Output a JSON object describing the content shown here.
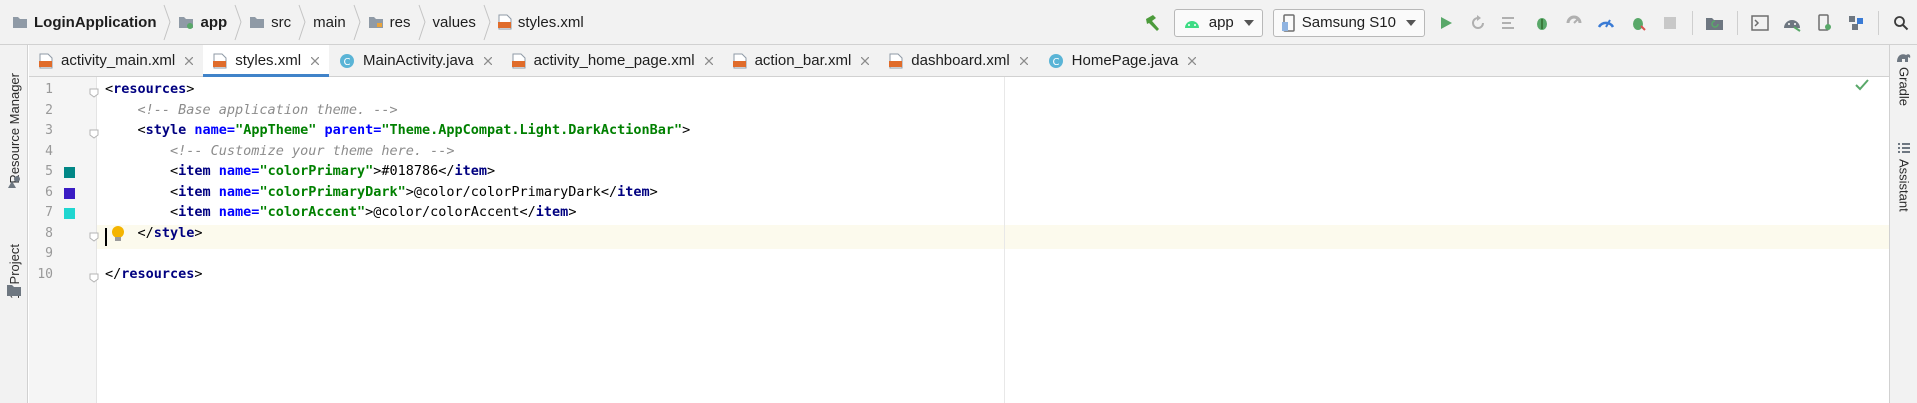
{
  "breadcrumbs": [
    {
      "label": "LoginApplication",
      "icon": "project-folder-icon",
      "bold": true
    },
    {
      "label": "app",
      "icon": "module-folder-icon",
      "bold": true
    },
    {
      "label": "src",
      "icon": "folder-icon",
      "bold": false
    },
    {
      "label": "main",
      "icon": "",
      "bold": false
    },
    {
      "label": "res",
      "icon": "resource-folder-icon",
      "bold": false
    },
    {
      "label": "values",
      "icon": "",
      "bold": false
    },
    {
      "label": "styles.xml",
      "icon": "xml-file-icon",
      "bold": false
    }
  ],
  "toolbar": {
    "run_config": "app",
    "device": "Samsung S10",
    "icons": [
      "hammer-icon",
      "android-icon",
      "device-icon",
      "run-icon",
      "rerun-icon",
      "coverage-icon",
      "debug-icon",
      "profile-icon",
      "apply-changes-icon",
      "attach-debugger-icon",
      "stop-icon",
      "sync-gradle-icon",
      "terminal-icon",
      "sdk-manager-icon",
      "avd-manager-icon",
      "project-structure-icon",
      "search-icon"
    ]
  },
  "left_strip": {
    "resource_manager": "Resource Manager",
    "project": "1: Project"
  },
  "right_strip": {
    "gradle": "Gradle",
    "assistant": "Assistant"
  },
  "tabs": [
    {
      "label": "activity_main.xml",
      "type": "xml",
      "active": false
    },
    {
      "label": "styles.xml",
      "type": "xml",
      "active": true
    },
    {
      "label": "MainActivity.java",
      "type": "java",
      "active": false
    },
    {
      "label": "activity_home_page.xml",
      "type": "xml",
      "active": false
    },
    {
      "label": "action_bar.xml",
      "type": "xml",
      "active": false
    },
    {
      "label": "dashboard.xml",
      "type": "xml",
      "active": false
    },
    {
      "label": "HomePage.java",
      "type": "java",
      "active": false
    }
  ],
  "editor": {
    "lines": [
      {
        "num": "1",
        "tokens": [
          {
            "t": "<",
            "c": "txt"
          },
          {
            "t": "resources",
            "c": "tag"
          },
          {
            "t": ">",
            "c": "txt"
          }
        ]
      },
      {
        "num": "2",
        "tokens": [
          {
            "t": "    ",
            "c": "txt"
          },
          {
            "t": "<!-- Base application theme. -->",
            "c": "cmt"
          }
        ]
      },
      {
        "num": "3",
        "tokens": [
          {
            "t": "    <",
            "c": "txt"
          },
          {
            "t": "style ",
            "c": "tag"
          },
          {
            "t": "name=",
            "c": "attr"
          },
          {
            "t": "\"AppTheme\" ",
            "c": "val"
          },
          {
            "t": "parent=",
            "c": "attr"
          },
          {
            "t": "\"Theme.AppCompat.Light.DarkActionBar\"",
            "c": "val"
          },
          {
            "t": ">",
            "c": "txt"
          }
        ]
      },
      {
        "num": "4",
        "tokens": [
          {
            "t": "        ",
            "c": "txt"
          },
          {
            "t": "<!-- Customize your theme here. -->",
            "c": "cmt"
          }
        ]
      },
      {
        "num": "5",
        "tokens": [
          {
            "t": "        <",
            "c": "txt"
          },
          {
            "t": "item ",
            "c": "tag"
          },
          {
            "t": "name=",
            "c": "attr"
          },
          {
            "t": "\"colorPrimary\"",
            "c": "val"
          },
          {
            "t": ">#018786</",
            "c": "txt"
          },
          {
            "t": "item",
            "c": "tag"
          },
          {
            "t": ">",
            "c": "txt"
          }
        ]
      },
      {
        "num": "6",
        "tokens": [
          {
            "t": "        <",
            "c": "txt"
          },
          {
            "t": "item ",
            "c": "tag"
          },
          {
            "t": "name=",
            "c": "attr"
          },
          {
            "t": "\"colorPrimaryDark\"",
            "c": "val"
          },
          {
            "t": ">@color/colorPrimaryDark</",
            "c": "txt"
          },
          {
            "t": "item",
            "c": "tag"
          },
          {
            "t": ">",
            "c": "txt"
          }
        ]
      },
      {
        "num": "7",
        "tokens": [
          {
            "t": "        <",
            "c": "txt"
          },
          {
            "t": "item ",
            "c": "tag"
          },
          {
            "t": "name=",
            "c": "attr"
          },
          {
            "t": "\"colorAccent\"",
            "c": "val"
          },
          {
            "t": ">@color/colorAccent</",
            "c": "txt"
          },
          {
            "t": "item",
            "c": "tag"
          },
          {
            "t": ">",
            "c": "txt"
          }
        ]
      },
      {
        "num": "8",
        "tokens": [
          {
            "t": "    </",
            "c": "txt"
          },
          {
            "t": "style",
            "c": "tag"
          },
          {
            "t": ">",
            "c": "txt"
          }
        ]
      },
      {
        "num": "9",
        "tokens": []
      },
      {
        "num": "10",
        "tokens": [
          {
            "t": "</",
            "c": "txt"
          },
          {
            "t": "resources",
            "c": "tag"
          },
          {
            "t": ">",
            "c": "txt"
          }
        ]
      }
    ],
    "swatches": {
      "line5": "#018786",
      "line6": "#3a1cc4",
      "line7": "#1fd6d0"
    }
  },
  "colors": {
    "accent_tab_underline": "#4083c9",
    "hammer": "#4c9b3b",
    "run": "#59a869",
    "android": "#3ddc84"
  }
}
